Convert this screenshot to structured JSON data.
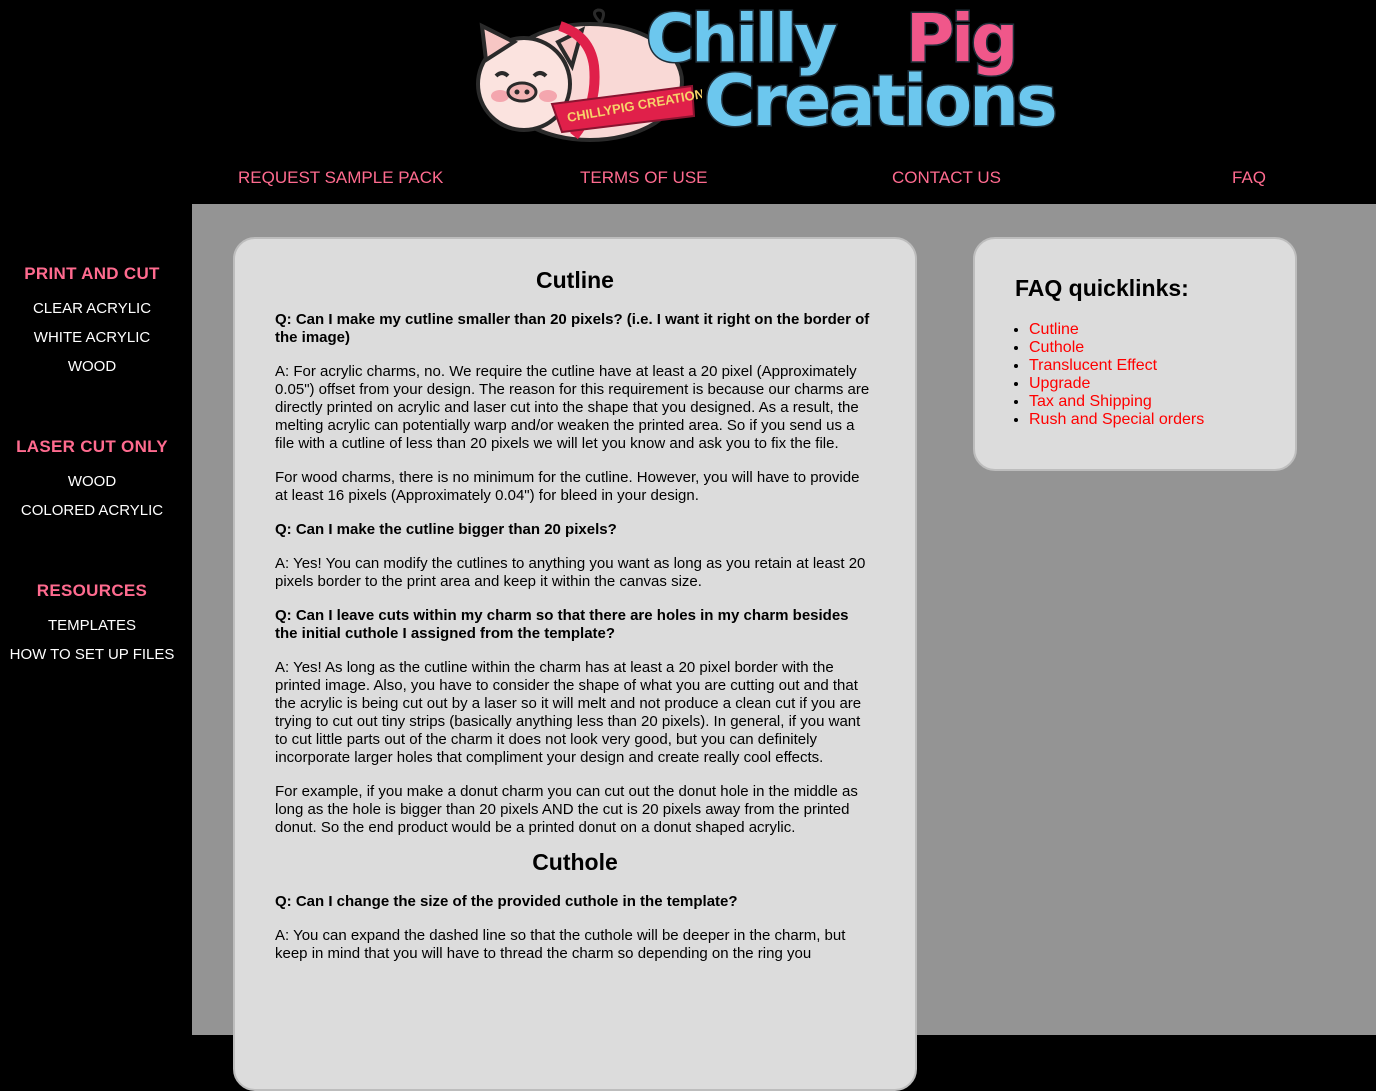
{
  "brand": {
    "logo_line1_word1": "Chilly",
    "logo_line1_word2": "Pig",
    "logo_line2": "Creations",
    "ribbon_text": "CHILLYPIG CREATIONS",
    "colors": {
      "blue": "#6cc7ee",
      "pink": "#f0578a",
      "ribbon": "#e0204a"
    }
  },
  "topnav": {
    "items": [
      {
        "label": "REQUEST SAMPLE PACK"
      },
      {
        "label": "TERMS OF USE"
      },
      {
        "label": "CONTACT US"
      },
      {
        "label": "FAQ"
      }
    ],
    "color": "#ff6b8f"
  },
  "sidebar": {
    "sections": [
      {
        "heading": "PRINT AND CUT",
        "items": [
          "CLEAR ACRYLIC",
          "WHITE ACRYLIC",
          "WOOD"
        ]
      },
      {
        "heading": "LASER CUT ONLY",
        "items": [
          "WOOD",
          "COLORED ACRYLIC"
        ]
      },
      {
        "heading": "RESOURCES",
        "items": [
          "TEMPLATES",
          "HOW TO SET UP FILES"
        ]
      }
    ]
  },
  "main": {
    "sections": [
      {
        "title": "Cutline",
        "blocks": [
          {
            "q": "Q: Can I make my cutline smaller than 20 pixels? (i.e. I want it right on the border of the image)"
          },
          {
            "a": "A: For acrylic charms, no. We require the cutline have at least a 20 pixel (Approximately 0.05\") offset from your design. The reason for this requirement is because our charms are directly printed on acrylic and laser cut into the shape that you designed. As a result, the melting acrylic can potentially warp and/or weaken the printed area. So if you send us a file with a cutline of less than 20 pixels we will let you know and ask you to fix the file."
          },
          {
            "a": "For wood charms, there is no minimum for the cutline. However, you will have to provide at least 16 pixels (Approximately 0.04\") for bleed in your design."
          },
          {
            "q": "Q: Can I make the cutline bigger than 20 pixels?"
          },
          {
            "a": "A: Yes! You can modify the cutlines to anything you want as long as you retain at least 20 pixels border to the print area and keep it within the canvas size."
          },
          {
            "q": "Q: Can I leave cuts within my charm so that there are holes in my charm besides the initial cuthole I assigned from the template?"
          },
          {
            "a": "A: Yes! As long as the cutline within the charm has at least a 20 pixel border with the printed image. Also, you have to consider the shape of what you are cutting out and that the acrylic is being cut out by a laser so it will melt and not produce a clean cut if you are trying to cut out tiny strips (basically anything less than 20 pixels). In general, if you want to cut little parts out of the charm it does not look very good, but you can definitely incorporate larger holes that compliment your design and create really cool effects."
          },
          {
            "a": "For example, if you make a donut charm you can cut out the donut hole in the middle as long as the hole is bigger than 20 pixels AND the cut is 20 pixels away from the printed donut. So the end product would be a printed donut on a donut shaped acrylic."
          }
        ]
      },
      {
        "title": "Cuthole",
        "blocks": [
          {
            "q": "Q: Can I change the size of the provided cuthole in the template?"
          },
          {
            "a": "A: You can expand the dashed line so that the cuthole will be deeper in the charm, but keep in mind that you will have to thread the charm so depending on the ring you"
          }
        ]
      }
    ]
  },
  "quicklinks": {
    "title": "FAQ quicklinks:",
    "items": [
      "Cutline",
      "Cuthole",
      "Translucent Effect",
      "Upgrade",
      "Tax and Shipping",
      "Rush and Special orders"
    ],
    "link_color": "#ff0000"
  }
}
